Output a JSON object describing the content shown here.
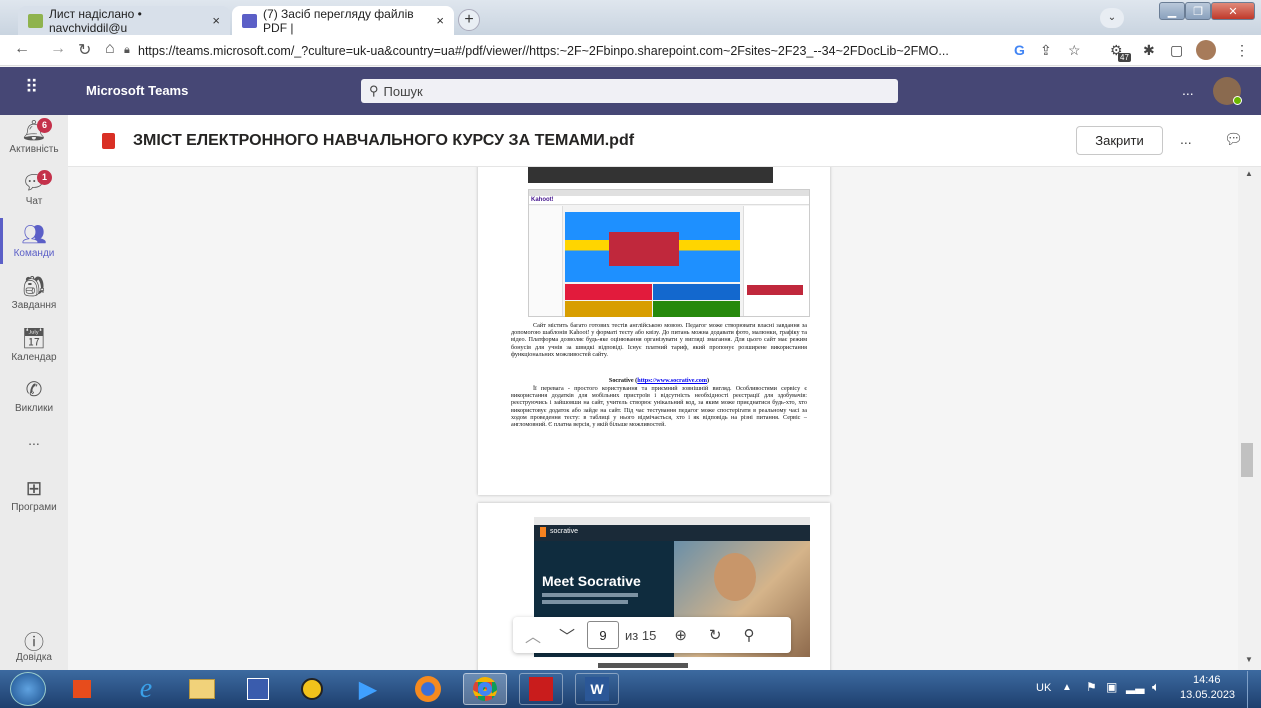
{
  "browser": {
    "tabs": [
      {
        "label": "Лист надіслано • navchviddil@u",
        "close": "×"
      },
      {
        "label": "(7) Засіб перегляду файлів PDF |",
        "close": "×"
      }
    ],
    "new_tab": "+",
    "url": "https://teams.microsoft.com/_?culture=uk-ua&country=ua#/pdf/viewer//https:~2F~2Fbinpo.sharepoint.com~2Fsites~2F23_--34~2FDocLib~2FMO...",
    "extension_badge": "47"
  },
  "teams": {
    "app_name": "Microsoft Teams",
    "search_placeholder": "Пошук",
    "more": "...",
    "sidebar": [
      {
        "label": "Активність",
        "badge": "6",
        "icon": "bell-icon"
      },
      {
        "label": "Чат",
        "badge": "1",
        "icon": "chat-icon"
      },
      {
        "label": "Команди",
        "badge": "",
        "icon": "teams-icon"
      },
      {
        "label": "Завдання",
        "badge": "",
        "icon": "assignments-icon"
      },
      {
        "label": "Календар",
        "badge": "",
        "icon": "calendar-icon"
      },
      {
        "label": "Виклики",
        "badge": "",
        "icon": "phone-icon"
      },
      {
        "label": "...",
        "badge": "",
        "icon": "more-icon"
      },
      {
        "label": "Програми",
        "badge": "",
        "icon": "apps-icon"
      }
    ],
    "help_label": "Довідка",
    "doc_title": "ЗМІСТ ЕЛЕКТРОННОГО НАВЧАЛЬНОГО КУРСУ ЗА ТЕМАМИ.pdf",
    "close_label": "Закрити",
    "doc_more": "..."
  },
  "pdf": {
    "kahoot_paragraph": "Сайт містить багато готових тестів англійською мовою. Педагог може створювати власні завдання за допомогою шаблонів Kahoot! у форматі тесту або квізу. До питань можна додавати фото, малюнки, графіку та відео. Платформа дозволяє будь-яке оцінювання організувати у вигляді змагання. Для цього сайт має режим бонусів для учнів за швидкі відповіді. Існує платний тариф, який пропонує розширене використання функціональних можливостей сайту.",
    "socrative_heading": "Socrative (",
    "socrative_link": "https://www.socrative.com",
    "socrative_heading_end": ")",
    "socrative_paragraph": "Її перевага - простого користування та приємний зовнішній вигляд. Особливостями сервісу є використання додатків для мобільних пристроїв і відсутність необхідності реєстрації для здобувачів: реєструючись і зайшовши на сайт, учитель створює унікальний код, за яким може приєднатися будь-хто, хто використовує додаток або зайде на сайт. Під час тестування педагог може спостерігати в реальному часі за ходом проведення тесту: в таблиці у нього відмічається, хто і як відповідь на різні питання. Сервіс – англомовний. Є платна версія, у якій більше можливостей.",
    "socrative_hero_title": "Meet Socrative",
    "socrative_brand": "socrative",
    "page_current": "9",
    "page_of": "из 15"
  },
  "taskbar": {
    "lang": "UK",
    "time": "14:46",
    "date": "13.05.2023"
  }
}
